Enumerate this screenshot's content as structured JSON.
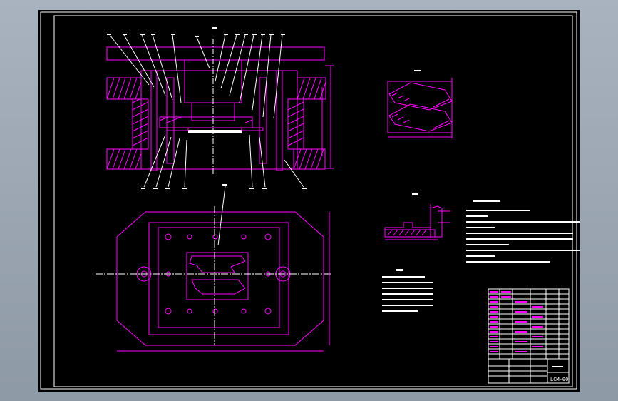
{
  "drawing": {
    "number": "LCM-00",
    "views": [
      "main-section-view",
      "plan-view",
      "detail-view-a",
      "detail-view-b",
      "notes-block",
      "parts-list-table"
    ]
  },
  "colors": {
    "background_outer": "#9aa4b0",
    "sheet": "#000000",
    "border": "#ffffff",
    "geometry": "#ff00ff",
    "annotation": "#ffffff"
  }
}
